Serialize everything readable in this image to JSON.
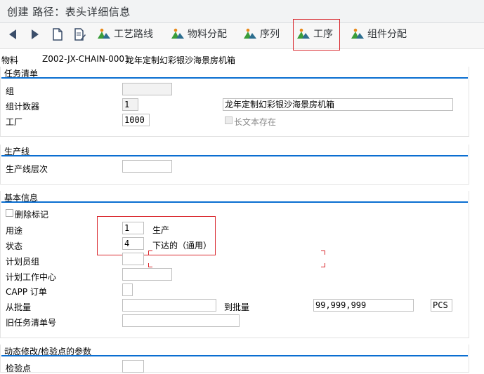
{
  "title": "创建 路径：表头详细信息",
  "toolbar": {
    "items": [
      {
        "label": "工艺路线",
        "icon": "mountain-icon"
      },
      {
        "label": "物料分配",
        "icon": "mountain-icon"
      },
      {
        "label": "序列",
        "icon": "mountain-icon"
      },
      {
        "label": "工序",
        "icon": "mountain-icon"
      },
      {
        "label": "组件分配",
        "icon": "mountain-icon"
      }
    ]
  },
  "material": {
    "label": "物料",
    "code": "Z002-JX-CHAIN-0001",
    "desc": "龙年定制幻彩银沙海景房机箱"
  },
  "task_list": {
    "title": "任务清单",
    "group_label": "组",
    "group_value": "",
    "group_counter_label": "组计数器",
    "group_counter_value": "1",
    "group_desc_value": "龙年定制幻彩银沙海景房机箱",
    "plant_label": "工厂",
    "plant_value": "1000",
    "long_text_label": "长文本存在"
  },
  "production_line": {
    "title": "生产线",
    "level_label": "生产线层次",
    "level_value": ""
  },
  "basic_info": {
    "title": "基本信息",
    "deletion_label": "删除标记",
    "usage_label": "用途",
    "usage_value": "1",
    "usage_text": "生产",
    "status_label": "状态",
    "status_value": "4",
    "status_text": "下达的（通用）",
    "planner_group_label": "计划员组",
    "planner_group_value": "",
    "plan_wc_label": "计划工作中心",
    "plan_wc_value": "",
    "capp_label": "CAPP 订单",
    "capp_value": "",
    "from_lot_label": "从批量",
    "from_lot_value": "",
    "to_lot_label": "到批量",
    "to_lot_value": "99,999,999",
    "unit_value": "PCS",
    "old_task_label": "旧任务清单号",
    "old_task_value": ""
  },
  "dynamic": {
    "title": "动态修改/检验点的参数",
    "inspection_point_label": "检验点"
  },
  "colors": {
    "accent": "#0a6ed1",
    "highlight": "#d9282e",
    "icon_green": "#3a9d3a",
    "icon_orange": "#e8891a",
    "icon_teal": "#2c6e8f"
  }
}
